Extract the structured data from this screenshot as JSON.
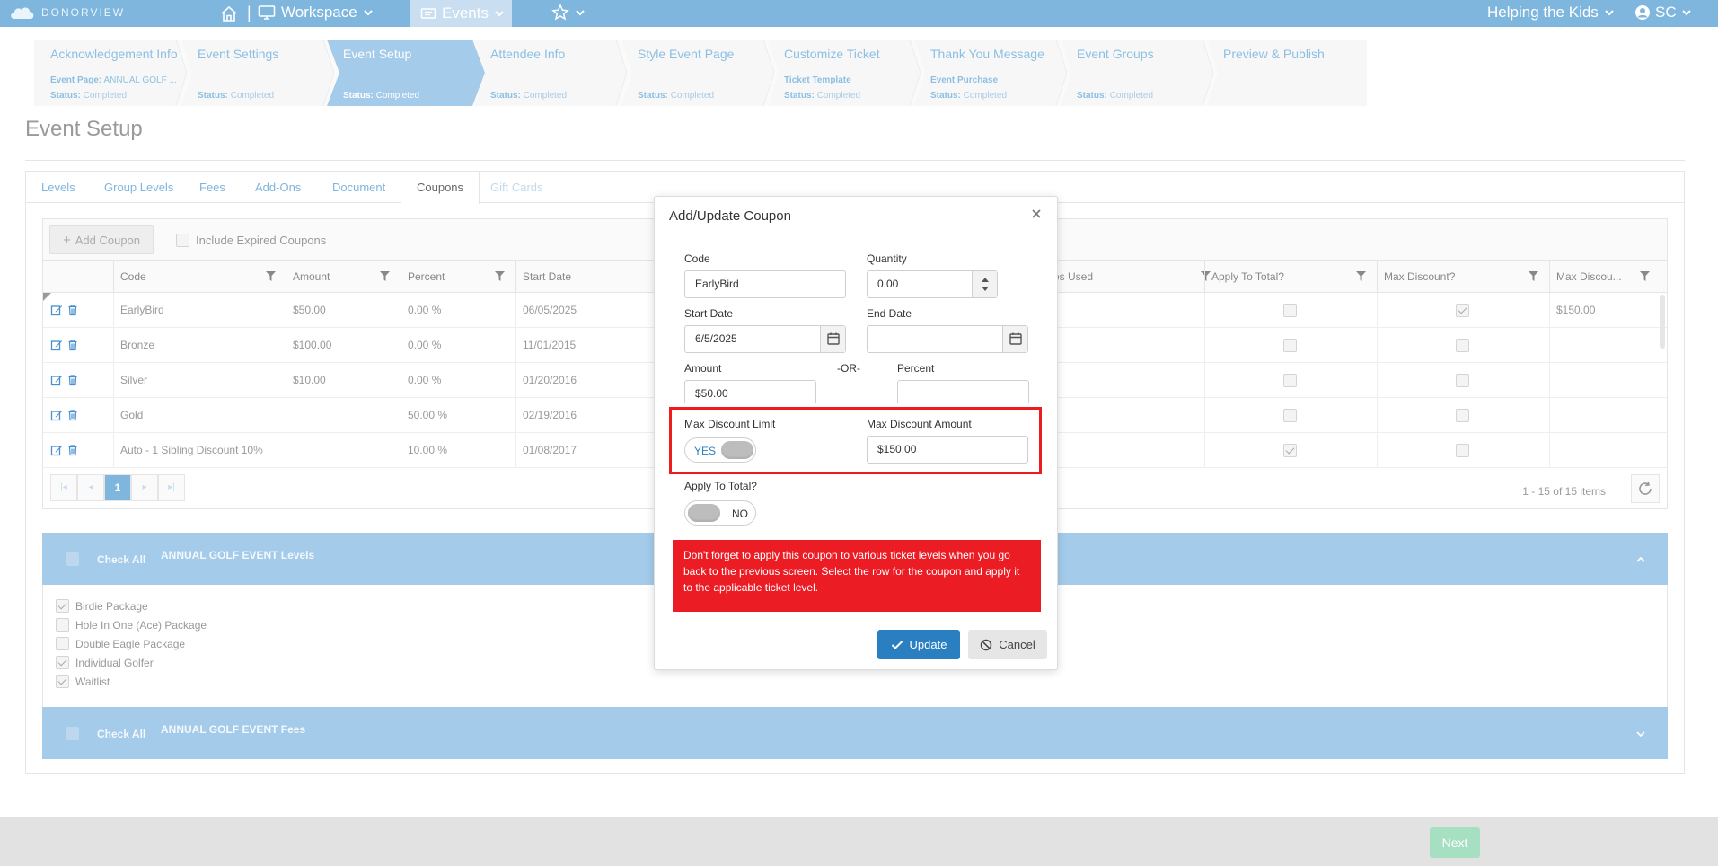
{
  "topnav": {
    "brand": "DONORVIEW",
    "workspace_label": "Workspace",
    "events_label": "Events",
    "org_label": "Helping the Kids",
    "user_initials": "SC"
  },
  "wizard": {
    "steps": [
      {
        "title": "Acknowledgement Info",
        "sub_label": "Event Page:",
        "sub_value": "ANNUAL GOLF ...",
        "status_label": "Status:",
        "status_value": "Completed"
      },
      {
        "title": "Event Settings",
        "sub_label": "",
        "sub_value": "",
        "status_label": "Status:",
        "status_value": "Completed"
      },
      {
        "title": "Event Setup",
        "sub_label": "",
        "sub_value": "",
        "status_label": "Status:",
        "status_value": "Completed"
      },
      {
        "title": "Attendee Info",
        "sub_label": "",
        "sub_value": "",
        "status_label": "Status:",
        "status_value": "Completed"
      },
      {
        "title": "Style Event Page",
        "sub_label": "",
        "sub_value": "",
        "status_label": "Status:",
        "status_value": "Completed"
      },
      {
        "title": "Customize Ticket",
        "sub_label": "Ticket Template",
        "sub_value": "",
        "status_label": "Status:",
        "status_value": "Completed"
      },
      {
        "title": "Thank You Message",
        "sub_label": "Event Purchase",
        "sub_value": "",
        "status_label": "Status:",
        "status_value": "Completed"
      },
      {
        "title": "Event Groups",
        "sub_label": "",
        "sub_value": "",
        "status_label": "Status:",
        "status_value": "Completed"
      },
      {
        "title": "Preview & Publish",
        "sub_label": "",
        "sub_value": "",
        "status_label": "",
        "status_value": ""
      }
    ]
  },
  "page": {
    "title": "Event Setup"
  },
  "tabs": [
    "Levels",
    "Group Levels",
    "Fees",
    "Add-Ons",
    "Document",
    "Coupons",
    "Gift Cards"
  ],
  "toolbar": {
    "add_coupon": "Add Coupon",
    "include_expired": "Include Expired Coupons"
  },
  "grid": {
    "columns": [
      "Code",
      "Amount",
      "Percent",
      "Start Date",
      "es Used",
      "Apply To Total?",
      "Max Discount?",
      "Max Discou..."
    ],
    "rows": [
      {
        "code": "EarlyBird",
        "amount": "$50.00",
        "percent": "0.00 %",
        "start": "06/05/2025",
        "apply_total": false,
        "max_discount": true,
        "max_amount": "$150.00"
      },
      {
        "code": "Bronze",
        "amount": "$100.00",
        "percent": "0.00 %",
        "start": "11/01/2015",
        "apply_total": false,
        "max_discount": false,
        "max_amount": ""
      },
      {
        "code": "Silver",
        "amount": "$10.00",
        "percent": "0.00 %",
        "start": "01/20/2016",
        "apply_total": false,
        "max_discount": false,
        "max_amount": ""
      },
      {
        "code": "Gold",
        "amount": "",
        "percent": "50.00 %",
        "start": "02/19/2016",
        "apply_total": false,
        "max_discount": false,
        "max_amount": ""
      },
      {
        "code": "Auto - 1 Sibling Discount 10%",
        "amount": "",
        "percent": "10.00 %",
        "start": "01/08/2017",
        "apply_total": true,
        "max_discount": false,
        "max_amount": ""
      }
    ],
    "current_page": "1",
    "page_info": "1 - 15 of 15 items"
  },
  "levels_section": {
    "check_all": "Check All",
    "title": "ANNUAL GOLF EVENT Levels",
    "items": [
      {
        "label": "Birdie Package",
        "checked": true
      },
      {
        "label": "Hole In One (Ace) Package",
        "checked": false
      },
      {
        "label": "Double Eagle Package",
        "checked": false
      },
      {
        "label": "Individual Golfer",
        "checked": true
      },
      {
        "label": "Waitlist",
        "checked": true
      }
    ]
  },
  "fees_section": {
    "check_all": "Check All",
    "title": "ANNUAL GOLF EVENT Fees"
  },
  "footer": {
    "next_label": "Next"
  },
  "modal": {
    "title": "Add/Update Coupon",
    "code_label": "Code",
    "code_value": "EarlyBird",
    "quantity_label": "Quantity",
    "quantity_value": "0.00",
    "start_label": "Start Date",
    "start_value": "6/5/2025",
    "end_label": "End Date",
    "end_value": "",
    "amount_label": "Amount",
    "amount_value": "$50.00",
    "or_label": "-OR-",
    "percent_label": "Percent",
    "percent_value": "",
    "max_limit_label": "Max Discount Limit",
    "max_limit_toggle": "YES",
    "max_amount_label": "Max Discount Amount",
    "max_amount_value": "$150.00",
    "apply_total_label": "Apply To Total?",
    "apply_total_toggle": "NO",
    "warning": "Don't forget to apply this coupon to various ticket levels when you go back to the previous screen. Select the row for the coupon and apply it to the applicable ticket level.",
    "update_label": "Update",
    "cancel_label": "Cancel"
  },
  "colors": {
    "nav_blue": "#7fb6de",
    "accordion_blue": "#a4cbea",
    "update_blue": "#2a7fc1",
    "warning_red": "#ec1c24",
    "highlight_red": "#ee1c1c",
    "next_green": "#a6dfc2"
  }
}
